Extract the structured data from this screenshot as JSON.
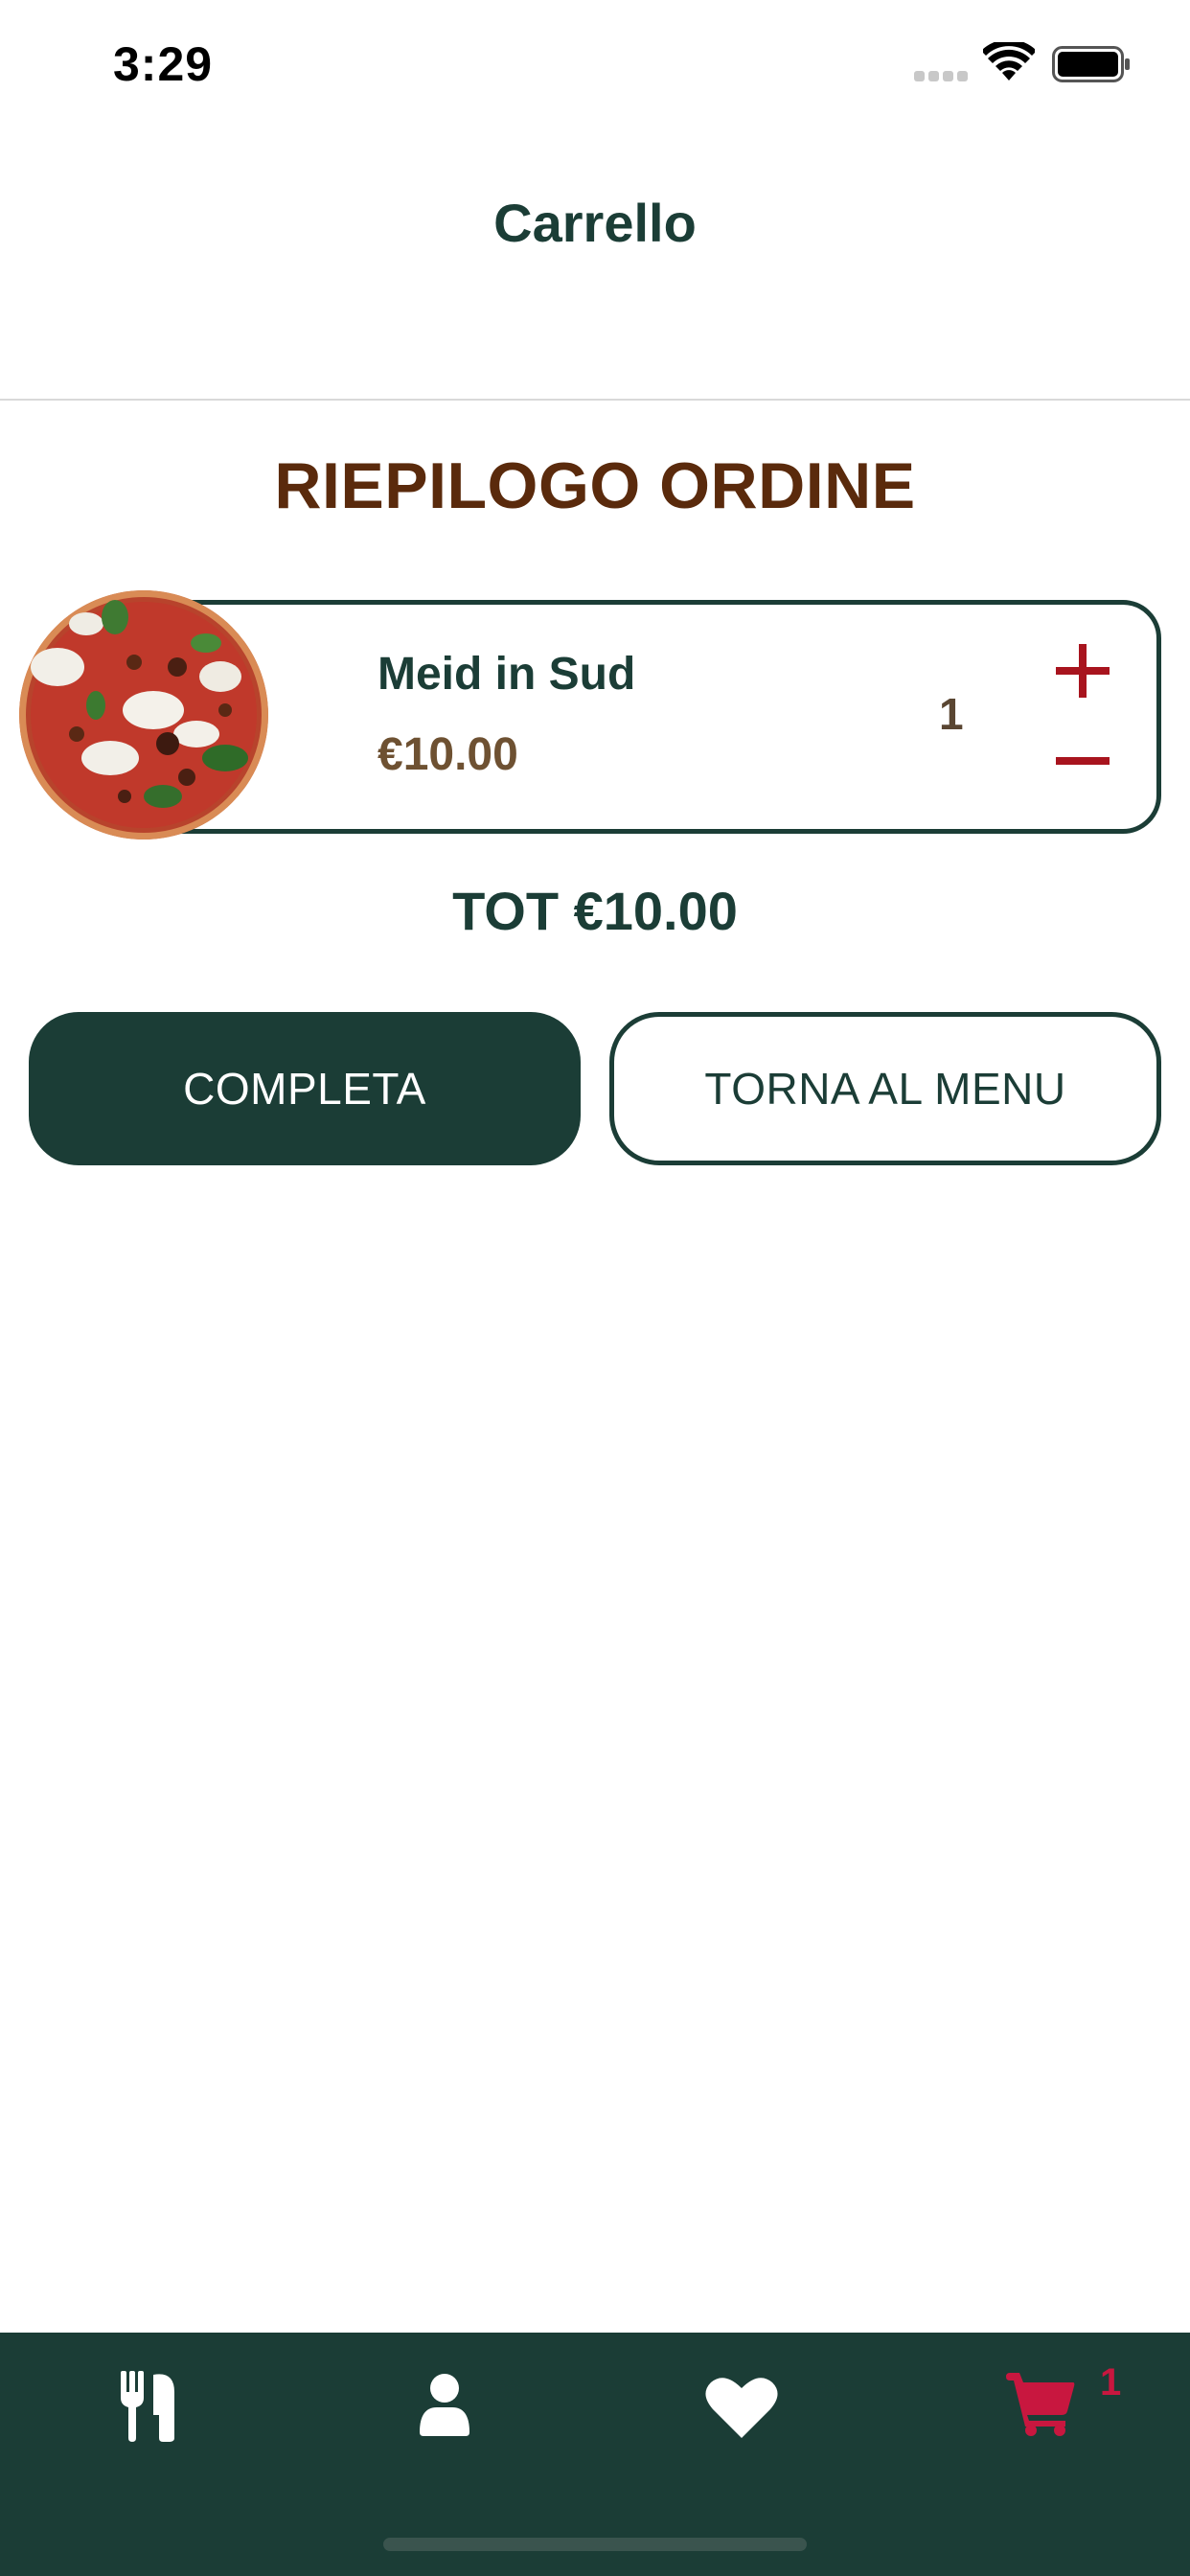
{
  "status_bar": {
    "time": "3:29"
  },
  "nav": {
    "title": "Carrello"
  },
  "summary": {
    "title": "RIEPILOGO ORDINE"
  },
  "cart": {
    "items": [
      {
        "name": "Meid in Sud",
        "price": "€10.00",
        "quantity": "1",
        "image": "pizza-photo"
      }
    ],
    "total": "TOT €10.00"
  },
  "actions": {
    "complete_label": "COMPLETA",
    "back_label": "TORNA AL MENU"
  },
  "tab_bar": {
    "tabs": [
      {
        "name": "menu",
        "icon": "fork-knife-icon"
      },
      {
        "name": "profile",
        "icon": "user-icon"
      },
      {
        "name": "favorites",
        "icon": "heart-icon"
      },
      {
        "name": "cart",
        "icon": "cart-icon",
        "active": true
      }
    ],
    "cart_badge": "1"
  },
  "colors": {
    "primary": "#1b3d36",
    "accent": "#c8173f",
    "title_brown": "#5a2a0c",
    "qty_red": "#a8141e"
  }
}
